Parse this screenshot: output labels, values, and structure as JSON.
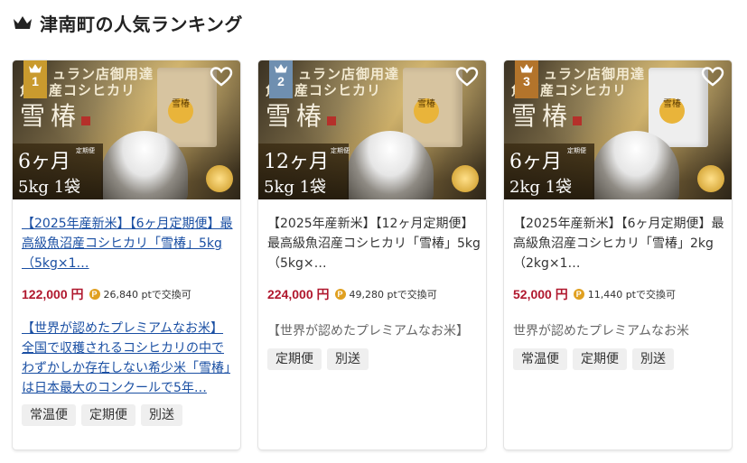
{
  "section": {
    "title": "津南町の人気ランキング",
    "icon": "crown-icon"
  },
  "colors": {
    "price": "#b0182e",
    "link": "#1a4fa3",
    "rank1": "#c99a2e",
    "rank2": "#6f8fb0",
    "rank3": "#b3742b"
  },
  "cards": [
    {
      "rank": "1",
      "image": {
        "brand_top": "ュラン店御用達",
        "brand_mid": "魚沼産コシヒカリ",
        "brand_big": "雪椿",
        "plan_term": "6ヶ月",
        "plan_label": "定期便",
        "plan_amount": "5kg 1袋",
        "bag_label": "雪椿"
      },
      "title": "【2025年産新米】【6ヶ月定期便】最高級魚沼産コシヒカリ「雪椿」5kg（5kg×1…",
      "price": "122,000 円",
      "points": "26,840 ptで交換可",
      "description": "【世界が認めたプレミアムなお米】全国で収穫されるコシヒカリの中でわずかしか存在しない希少米「雪椿」は日本最大のコンクールで5年…",
      "tags": [
        "常温便",
        "定期便",
        "別送"
      ]
    },
    {
      "rank": "2",
      "image": {
        "brand_top": "ュラン店御用達",
        "brand_mid": "魚沼産コシヒカリ",
        "brand_big": "雪椿",
        "plan_term": "12ヶ月",
        "plan_label": "定期便",
        "plan_amount": "5kg 1袋",
        "bag_label": "雪椿"
      },
      "title": "【2025年産新米】【12ヶ月定期便】最高級魚沼産コシヒカリ「雪椿」5kg（5kg×…",
      "price": "224,000 円",
      "points": "49,280 ptで交換可",
      "description": "【世界が認めたプレミアムなお米】",
      "tags": [
        "定期便",
        "別送"
      ]
    },
    {
      "rank": "3",
      "image": {
        "brand_top": "ュラン店御用達",
        "brand_mid": "魚沼産コシヒカリ",
        "brand_big": "雪椿",
        "plan_term": "6ヶ月",
        "plan_label": "定期便",
        "plan_amount": "2kg 1袋",
        "bag_label": "雪椿"
      },
      "title": "【2025年産新米】【6ヶ月定期便】最高級魚沼産コシヒカリ「雪椿」2kg（2kg×1…",
      "price": "52,000 円",
      "points": "11,440 ptで交換可",
      "description": "世界が認めたプレミアムなお米",
      "tags": [
        "常温便",
        "定期便",
        "別送"
      ]
    }
  ]
}
